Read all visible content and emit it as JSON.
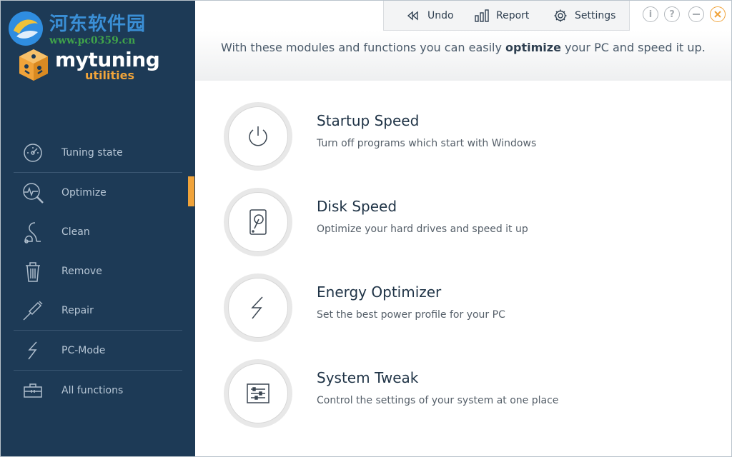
{
  "watermark": {
    "title": "河东软件园",
    "url": "www.pc0359.cn"
  },
  "brand": {
    "name": "mytuning",
    "sub": "utilities",
    "accent": "#f0a33a",
    "sidebar_bg": "#1d3a56"
  },
  "toolbar": {
    "undo_label": "Undo",
    "report_label": "Report",
    "settings_label": "Settings"
  },
  "window_controls": [
    "info-icon",
    "help-icon",
    "minimize-icon",
    "close-icon"
  ],
  "sidebar": {
    "items": [
      {
        "label": "Tuning state",
        "icon": "gauge-icon"
      },
      {
        "label": "Optimize",
        "icon": "pulse-magnifier-icon",
        "active": true
      },
      {
        "label": "Clean",
        "icon": "vacuum-icon"
      },
      {
        "label": "Remove",
        "icon": "trash-icon"
      },
      {
        "label": "Repair",
        "icon": "screwdriver-icon"
      },
      {
        "label": "PC-Mode",
        "icon": "lightning-icon"
      },
      {
        "label": "All functions",
        "icon": "toolbox-icon"
      }
    ]
  },
  "banner": {
    "text_before": "With these modules and functions you can easily ",
    "text_bold": "optimize",
    "text_after": " your PC and speed it up."
  },
  "modules": [
    {
      "title": "Startup Speed",
      "desc": "Turn off programs which start with Windows",
      "icon": "power-icon"
    },
    {
      "title": "Disk Speed",
      "desc": "Optimize your hard drives and speed it up",
      "icon": "hard-drive-icon"
    },
    {
      "title": "Energy Optimizer",
      "desc": "Set the best power profile for your PC",
      "icon": "lightning-icon"
    },
    {
      "title": "System Tweak",
      "desc": "Control the settings of your system at one place",
      "icon": "sliders-icon"
    }
  ]
}
